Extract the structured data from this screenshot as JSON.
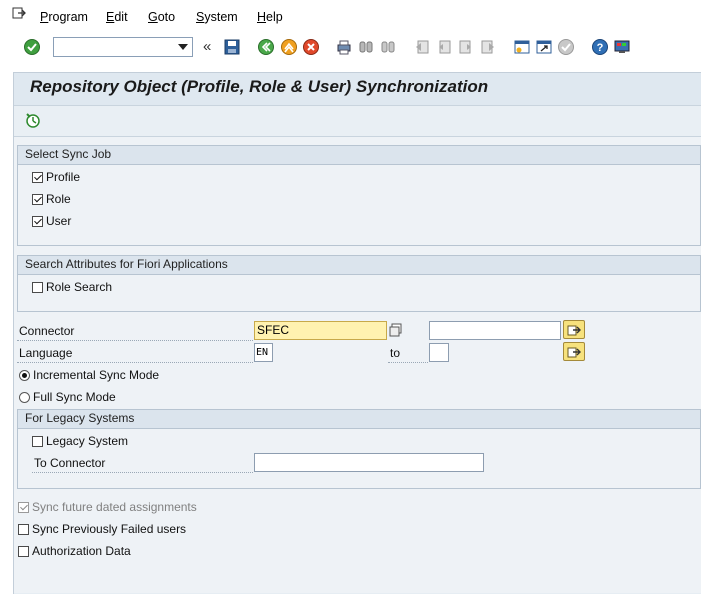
{
  "menu": {
    "items": [
      {
        "label": "Program",
        "ul": "P",
        "rest": "rogram"
      },
      {
        "label": "Edit",
        "ul": "E",
        "rest": "dit"
      },
      {
        "label": "Goto",
        "ul": "G",
        "rest": "oto"
      },
      {
        "label": "System",
        "ul": "S",
        "rest": "ystem"
      },
      {
        "label": "Help",
        "ul": "H",
        "rest": "elp"
      }
    ]
  },
  "toolbar": {
    "command_field_value": "",
    "icons": [
      "enter-icon",
      "command-dropdown",
      "back-history-icon",
      "save-icon",
      "back-icon",
      "exit-icon",
      "cancel-icon",
      "print-icon",
      "find-icon",
      "find-next-icon",
      "first-page-icon",
      "prev-page-icon",
      "next-page-icon",
      "last-page-icon",
      "create-session-icon",
      "shortcut-icon",
      "check-icon",
      "help-icon",
      "customize-layout-icon"
    ]
  },
  "page": {
    "title": "Repository Object (Profile, Role & User) Synchronization"
  },
  "sync_job": {
    "header": "Select Sync Job",
    "profile": {
      "label": "Profile",
      "checked": true
    },
    "role": {
      "label": "Role",
      "checked": true
    },
    "user": {
      "label": "User",
      "checked": true
    }
  },
  "fiori": {
    "header": "Search Attributes for Fiori Applications",
    "role_search": {
      "label": "Role Search",
      "checked": false
    }
  },
  "connector": {
    "label": "Connector",
    "value": "SFEC",
    "to_value": ""
  },
  "language": {
    "label": "Language",
    "value": "EN",
    "to_label": "to",
    "to_value": ""
  },
  "mode": {
    "incremental": {
      "label": "Incremental Sync Mode",
      "selected": true
    },
    "full": {
      "label": "Full Sync Mode",
      "selected": false
    }
  },
  "legacy": {
    "header": "For Legacy Systems",
    "legacy_system": {
      "label": "Legacy System",
      "checked": false
    },
    "to_connector_label": "To Connector",
    "to_connector_value": ""
  },
  "options": {
    "future_dated": {
      "label": "Sync future dated assignments",
      "checked": true,
      "disabled": true
    },
    "failed_users": {
      "label": "Sync Previously Failed users",
      "checked": false
    },
    "auth_data": {
      "label": "Authorization Data",
      "checked": false
    }
  },
  "colors": {
    "required_field": "#fff2b0",
    "panel_bg": "#eef2f6",
    "group_header": "#dbe4ed"
  }
}
